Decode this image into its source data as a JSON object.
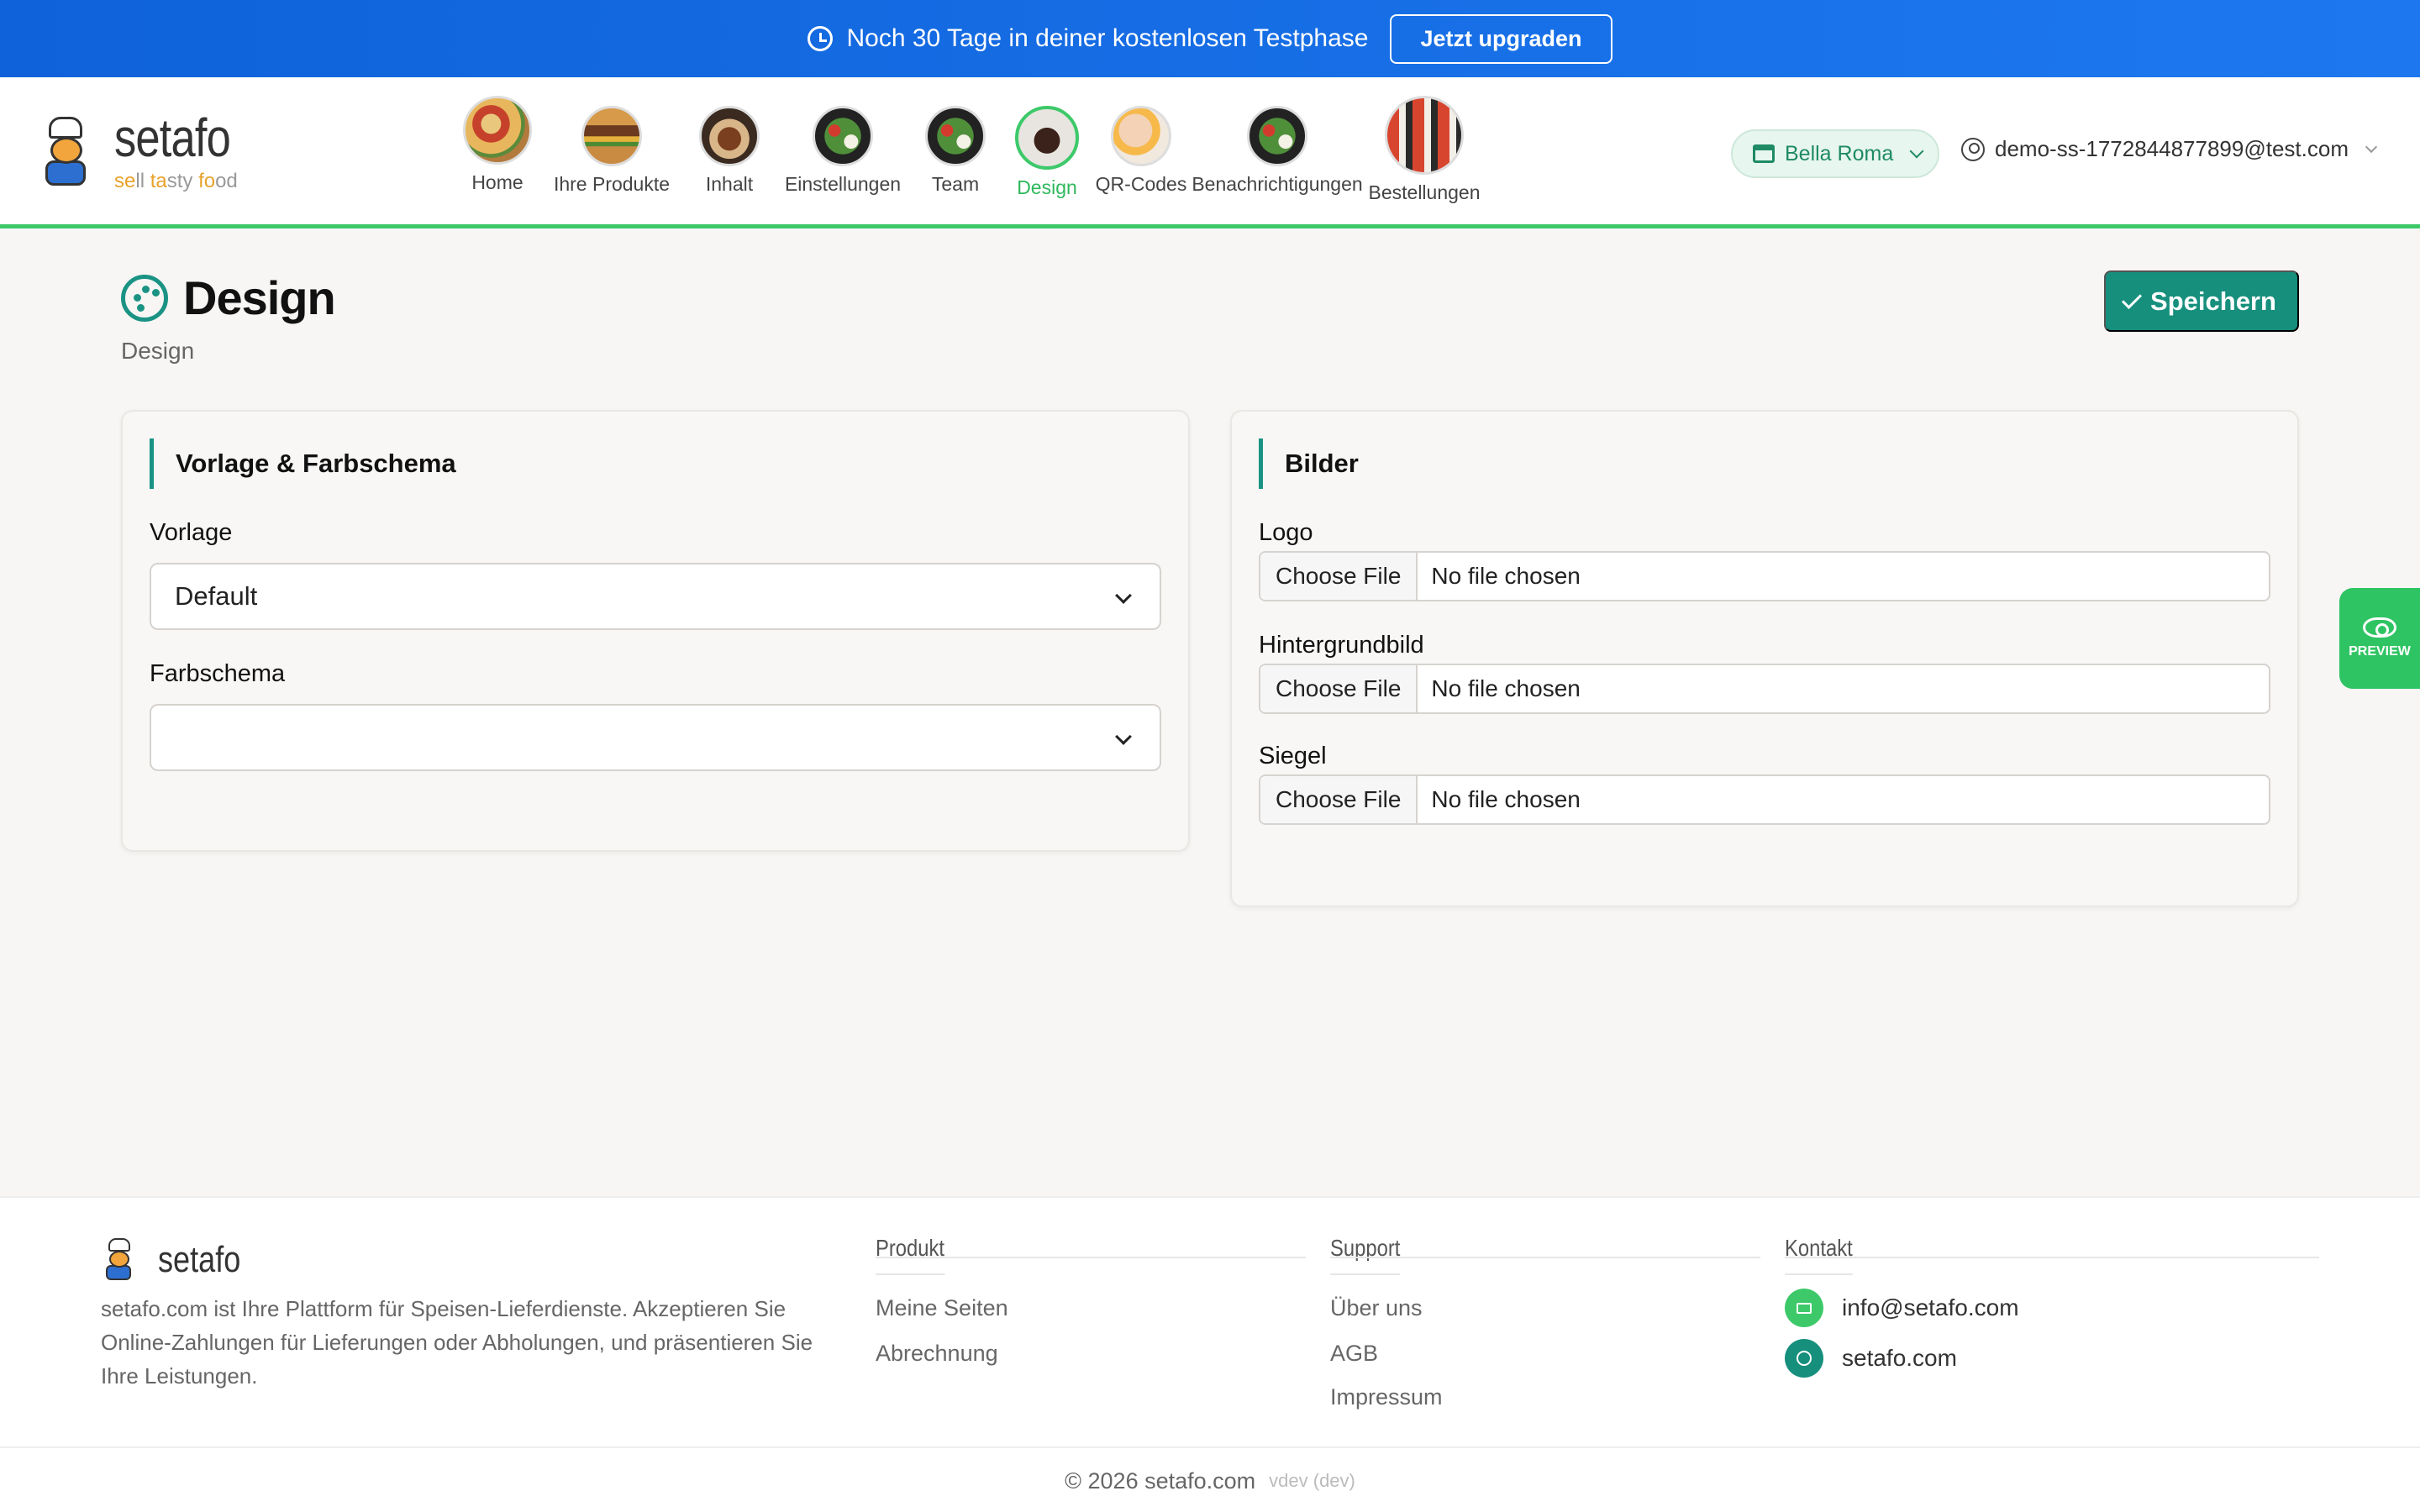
{
  "promo": {
    "text": "Noch 30 Tage in deiner kostenlosen Testphase",
    "button": "Jetzt upgraden"
  },
  "brand": {
    "name": "setafo",
    "tagline": "sell tasty food",
    "accent": "#3dc96a",
    "primary": "#168f7d"
  },
  "nav": {
    "items": [
      {
        "label": "Home",
        "icon": "pizza-icon"
      },
      {
        "label": "Ihre Produkte",
        "icon": "burger-icon"
      },
      {
        "label": "Inhalt",
        "icon": "dish-icon"
      },
      {
        "label": "Einstellungen",
        "icon": "salad-icon"
      },
      {
        "label": "Team",
        "icon": "salad-icon"
      },
      {
        "label": "Design",
        "icon": "dessert-icon",
        "active": true
      },
      {
        "label": "QR-Codes",
        "icon": "hand-icon"
      },
      {
        "label": "Benachrichtigungen",
        "icon": "salad-icon"
      },
      {
        "label": "Bestellungen",
        "icon": "sushi-icon"
      }
    ]
  },
  "header": {
    "restaurant": "Bella Roma",
    "user": "demo-ss-1772844877899@test.com"
  },
  "page": {
    "title": "Design",
    "breadcrumb": "Design",
    "save": "Speichern"
  },
  "template_card": {
    "title": "Vorlage & Farbschema",
    "vorlage_label": "Vorlage",
    "vorlage_value": "Default",
    "farbschema_label": "Farbschema",
    "farbschema_value": ""
  },
  "images_card": {
    "title": "Bilder",
    "fields": [
      {
        "label": "Logo",
        "button": "Choose File",
        "status": "No file chosen"
      },
      {
        "label": "Hintergrundbild",
        "button": "Choose File",
        "status": "No file chosen"
      },
      {
        "label": "Siegel",
        "button": "Choose File",
        "status": "No file chosen"
      }
    ]
  },
  "preview": {
    "label": "PREVIEW"
  },
  "footer": {
    "brand": "setafo",
    "description": "setafo.com ist Ihre Plattform für Speisen-Lieferdienste. Akzeptieren Sie Online-Zahlungen für Lieferungen oder Abholungen, und präsentieren Sie Ihre Leistungen.",
    "produkt": {
      "title": "Produkt",
      "links": [
        "Meine Seiten",
        "Abrechnung"
      ]
    },
    "support": {
      "title": "Support",
      "links": [
        "Über uns",
        "AGB",
        "Impressum"
      ]
    },
    "kontakt": {
      "title": "Kontakt",
      "email": "info@setafo.com",
      "web": "setafo.com"
    },
    "copyright": "© 2026 setafo.com",
    "version": "vdev (dev)"
  }
}
